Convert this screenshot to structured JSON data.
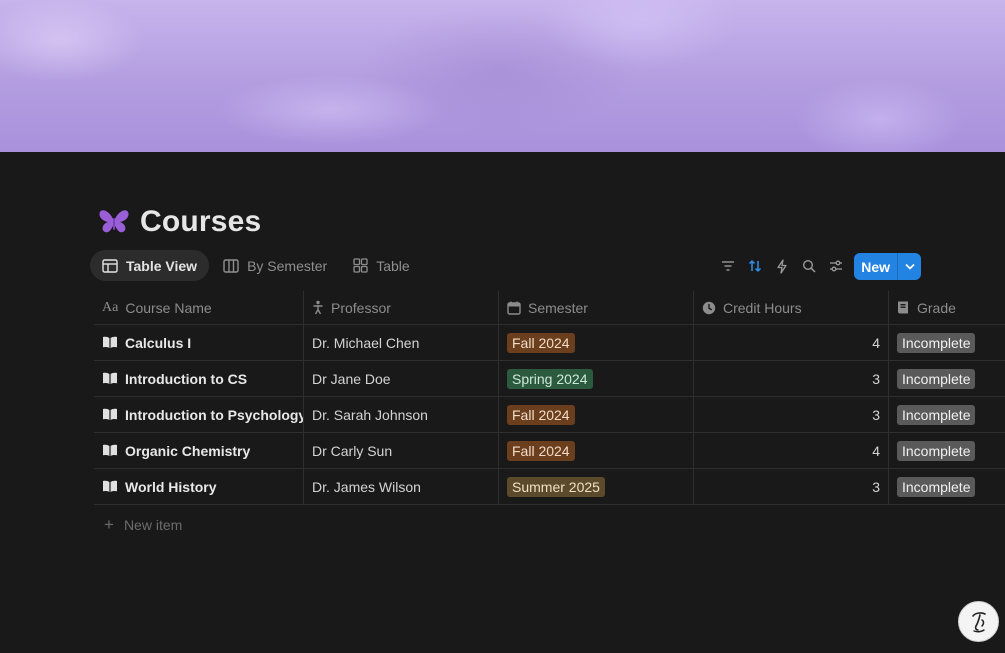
{
  "page": {
    "title": "Courses",
    "title_icon": "butterfly-icon"
  },
  "views": [
    {
      "label": "Table View",
      "icon": "table-icon",
      "active": true
    },
    {
      "label": "By Semester",
      "icon": "board-icon",
      "active": false
    },
    {
      "label": "Table",
      "icon": "gallery-icon",
      "active": false
    }
  ],
  "toolbar": {
    "icons": [
      "filter-icon",
      "sort-icon",
      "automation-icon",
      "search-icon",
      "settings-icon"
    ],
    "new_label": "New",
    "accent": "#2383e2"
  },
  "columns": [
    {
      "label": "Course Name",
      "icon": "text-icon"
    },
    {
      "label": "Professor",
      "icon": "person-icon"
    },
    {
      "label": "Semester",
      "icon": "calendar-icon"
    },
    {
      "label": "Credit Hours",
      "icon": "clock-icon"
    },
    {
      "label": "Grade",
      "icon": "book-icon"
    }
  ],
  "rows": [
    {
      "name": "Calculus I",
      "professor": "Dr. Michael Chen",
      "semester": "Fall 2024",
      "semester_color": "#6b3f1e",
      "credits": "4",
      "grade": "Incomplete"
    },
    {
      "name": "Introduction to CS",
      "professor": "Dr Jane Doe",
      "semester": "Spring 2024",
      "semester_color": "#2b5a3f",
      "credits": "3",
      "grade": "Incomplete"
    },
    {
      "name": "Introduction to Psychology",
      "professor": "Dr. Sarah Johnson",
      "semester": "Fall 2024",
      "semester_color": "#6b3f1e",
      "credits": "3",
      "grade": "Incomplete"
    },
    {
      "name": "Organic Chemistry",
      "professor": "Dr Carly Sun",
      "semester": "Fall 2024",
      "semester_color": "#6b3f1e",
      "credits": "4",
      "grade": "Incomplete"
    },
    {
      "name": "World History",
      "professor": "Dr. James Wilson",
      "semester": "Summer 2025",
      "semester_color": "#5c4a2c",
      "credits": "3",
      "grade": "Incomplete"
    }
  ],
  "new_item_label": "New item",
  "colors": {
    "background": "#191919",
    "cover": "#b39de0",
    "grade_tag": "#5a5a5a"
  }
}
